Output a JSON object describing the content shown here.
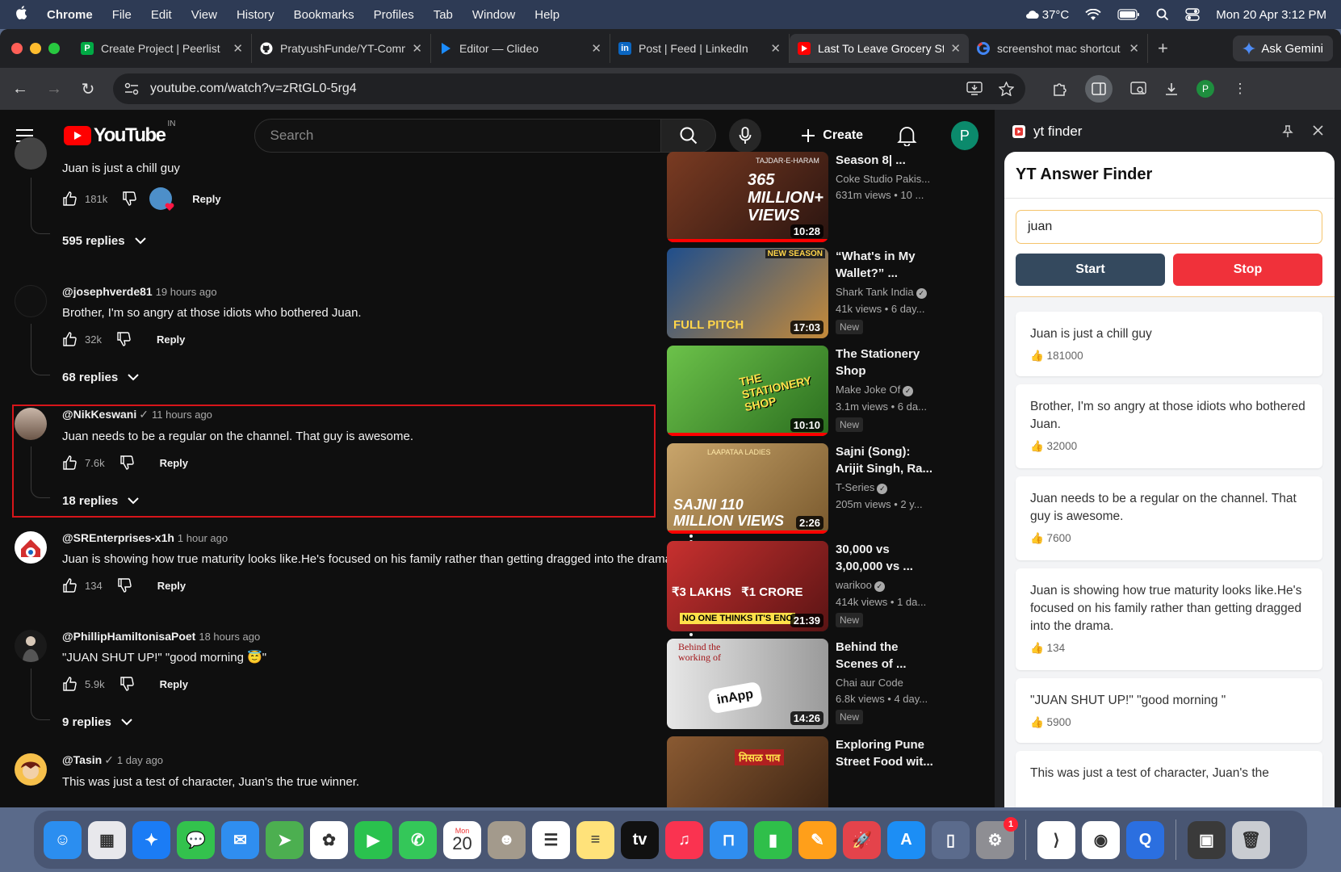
{
  "menubar": {
    "app": "Chrome",
    "items": [
      "File",
      "Edit",
      "View",
      "History",
      "Bookmarks",
      "Profiles",
      "Tab",
      "Window",
      "Help"
    ],
    "weather": "37°C",
    "datetime": "Mon 20 Apr  3:12 PM"
  },
  "tabs": [
    {
      "label": "Create Project | Peerlist",
      "fav_letter": "P",
      "fav_color": "#00aa45"
    },
    {
      "label": "PratyushFunde/YT-Comments",
      "fav_letter": "",
      "fav_color": "#ffffff"
    },
    {
      "label": "Editor — Clideo",
      "fav_letter": "",
      "fav_color": "#1b8cff"
    },
    {
      "label": "Post | Feed | LinkedIn",
      "fav_letter": "in",
      "fav_color": "#0a66c2"
    },
    {
      "label": "Last To Leave Grocery Store",
      "fav_letter": "",
      "fav_color": "#ff0000"
    },
    {
      "label": "screenshot mac shortcut",
      "fav_letter": "",
      "fav_color": "#ffffff"
    }
  ],
  "browser": {
    "ask_gemini": "Ask Gemini",
    "url": "youtube.com/watch?v=zRtGL0-5rg4",
    "profile_letter": "P"
  },
  "youtube": {
    "logo_text": "YouTube",
    "region": "IN",
    "search_placeholder": "Search",
    "create_label": "Create",
    "avatar_letter": "P",
    "comments": [
      {
        "author": "",
        "ago": "",
        "verified": false,
        "text": "Juan is just a chill guy",
        "likes": "181k",
        "reply": "Reply",
        "replies": "595 replies",
        "hearted": true
      },
      {
        "author": "@josephverde81",
        "ago": "19 hours ago",
        "verified": false,
        "text": "Brother, I'm so angry at those idiots who bothered Juan.",
        "likes": "32k",
        "reply": "Reply",
        "replies": "68 replies"
      },
      {
        "author": "@NikKeswani",
        "ago": "11 hours ago",
        "verified": true,
        "text": "Juan needs to be a regular on the channel. That guy is awesome.",
        "likes": "7.6k",
        "reply": "Reply",
        "replies": "18 replies"
      },
      {
        "author": "@SREnterprises-x1h",
        "ago": "1 hour ago",
        "verified": false,
        "text": "Juan is showing how true maturity looks like.He's focused on his family rather than getting dragged into the drama.",
        "likes": "134",
        "reply": "Reply",
        "replies": ""
      },
      {
        "author": "@PhillipHamiltonisaPoet",
        "ago": "18 hours ago",
        "verified": false,
        "text": "\"JUAN SHUT UP!\" \"good morning 😇\"",
        "likes": "5.9k",
        "reply": "Reply",
        "replies": "9 replies"
      },
      {
        "author": "@Tasin",
        "ago": "1 day ago",
        "verified": true,
        "text": "This was just a test of character, Juan's the true winner.",
        "likes": "",
        "reply": "",
        "replies": ""
      }
    ],
    "related": [
      {
        "title": "Season 8| ...",
        "channel": "Coke Studio Pakis...",
        "meta": "631m views • 10 ...",
        "duration": "10:28",
        "new": "",
        "verified": false,
        "thumb_color": "#5a2a1e",
        "thumb_text": "365 MILLION+ VIEWS",
        "thumb_top": "TAJDAR-E-HARAM"
      },
      {
        "title": "“What's in My Wallet?” ...",
        "channel": "Shark Tank India",
        "meta": "41k views • 6 day...",
        "duration": "17:03",
        "new": "New",
        "verified": true,
        "thumb_color": "#2a4f80",
        "thumb_text": "FULL PITCH",
        "thumb_top": "NEW SEASON"
      },
      {
        "title": "The Stationery Shop",
        "channel": "Make Joke Of",
        "meta": "3.1m views • 6 da...",
        "duration": "10:10",
        "new": "New",
        "verified": true,
        "thumb_color": "#3f8f3a",
        "thumb_text": "THE STATIONERY SHOP",
        "thumb_top": ""
      },
      {
        "title": "Sajni (Song): Arijit Singh, Ra...",
        "channel": "T-Series",
        "meta": "205m views • 2 y...",
        "duration": "2:26",
        "new": "",
        "verified": true,
        "thumb_color": "#b08a55",
        "thumb_text": "SAJNI 110 MILLION VIEWS",
        "thumb_top": "LAAPATAA LADIES"
      },
      {
        "title": "30,000 vs 3,00,000 vs ...",
        "channel": "warikoo",
        "meta": "414k views • 1 da...",
        "duration": "21:39",
        "new": "New",
        "verified": true,
        "thumb_color": "#a8262a",
        "thumb_text": "₹3 LAKHS   ₹1 CRORE",
        "thumb_top": "NO ONE THINKS IT'S ENO"
      },
      {
        "title": "Behind the Scenes of ...",
        "channel": "Chai aur Code",
        "meta": "6.8k views • 4 day...",
        "duration": "14:26",
        "new": "New",
        "verified": false,
        "thumb_color": "#d9d9d9",
        "thumb_text": "inApp",
        "thumb_top": "Behind the working of"
      },
      {
        "title": "Exploring Pune Street Food wit...",
        "channel": "",
        "meta": "",
        "duration": "",
        "new": "",
        "verified": false,
        "thumb_color": "#7a4b2a",
        "thumb_text": "मिसळ पाव",
        "thumb_top": ""
      }
    ]
  },
  "sidepanel": {
    "title": "yt finder",
    "card_title": "YT Answer Finder",
    "input_value": "juan",
    "start_label": "Start",
    "stop_label": "Stop",
    "results": [
      {
        "text": "Juan is just a chill guy",
        "likes": "👍 181000"
      },
      {
        "text": "Brother, I'm so angry at those idiots who bothered Juan.",
        "likes": "👍 32000"
      },
      {
        "text": "Juan needs to be a regular on the channel. That guy is awesome.",
        "likes": "👍 7600"
      },
      {
        "text": "Juan is showing how true maturity looks like.He's focused on his family rather than getting dragged into the drama.",
        "likes": "👍 134"
      },
      {
        "text": "\"JUAN SHUT UP!\" \"good morning \"",
        "likes": "👍 5900"
      },
      {
        "text": "This was just a test of character, Juan's the",
        "likes": ""
      }
    ]
  },
  "dock": {
    "apps": [
      {
        "name": "finder",
        "color": "#2b8ef0",
        "glyph": "☺"
      },
      {
        "name": "launchpad",
        "color": "#e8e8ec",
        "glyph": "▦"
      },
      {
        "name": "safari",
        "color": "#1b7cf5",
        "glyph": "✦"
      },
      {
        "name": "messages",
        "color": "#33c24d",
        "glyph": "💬"
      },
      {
        "name": "mail",
        "color": "#2f8ef0",
        "glyph": "✉"
      },
      {
        "name": "maps",
        "color": "#4caf50",
        "glyph": "➤"
      },
      {
        "name": "photos",
        "color": "#ffffff",
        "glyph": "✿"
      },
      {
        "name": "facetime",
        "color": "#2ac24e",
        "glyph": "▶"
      },
      {
        "name": "phone",
        "color": "#34c759",
        "glyph": "✆"
      },
      {
        "name": "calendar",
        "color": "#ffffff",
        "glyph": "20",
        "sub": "Mon"
      },
      {
        "name": "contacts",
        "color": "#a39a8c",
        "glyph": "☻"
      },
      {
        "name": "reminders",
        "color": "#ffffff",
        "glyph": "☰"
      },
      {
        "name": "notes",
        "color": "#ffe27a",
        "glyph": "≡"
      },
      {
        "name": "tv",
        "color": "#111111",
        "glyph": "tv"
      },
      {
        "name": "music",
        "color": "#fa3350",
        "glyph": "♫"
      },
      {
        "name": "keynote",
        "color": "#2f8ef0",
        "glyph": "⊓"
      },
      {
        "name": "numbers",
        "color": "#2fbf4a",
        "glyph": "▮"
      },
      {
        "name": "pages",
        "color": "#ff9f1a",
        "glyph": "✎"
      },
      {
        "name": "rocket",
        "color": "#e4434b",
        "glyph": "🚀"
      },
      {
        "name": "app-store",
        "color": "#1c8ef5",
        "glyph": "A"
      },
      {
        "name": "simulator",
        "color": "#5b6b8c",
        "glyph": "▯"
      },
      {
        "name": "system-settings",
        "color": "#8e8e93",
        "glyph": "⚙",
        "badge": "1"
      },
      {
        "name": "vscode",
        "color": "#ffffff",
        "glyph": "⟩"
      },
      {
        "name": "chrome",
        "color": "#ffffff",
        "glyph": "◉"
      },
      {
        "name": "quicktime",
        "color": "#2b6fe0",
        "glyph": "Q"
      },
      {
        "name": "preview-window",
        "color": "#3a3a3a",
        "glyph": "▣"
      },
      {
        "name": "trash",
        "color": "#c9ccd1",
        "glyph": "🗑"
      }
    ]
  },
  "colors": {
    "yt_red": "#ff0000",
    "stop_red": "#f0313a",
    "start_navy": "#34495e",
    "highlight": "#d7151a"
  }
}
